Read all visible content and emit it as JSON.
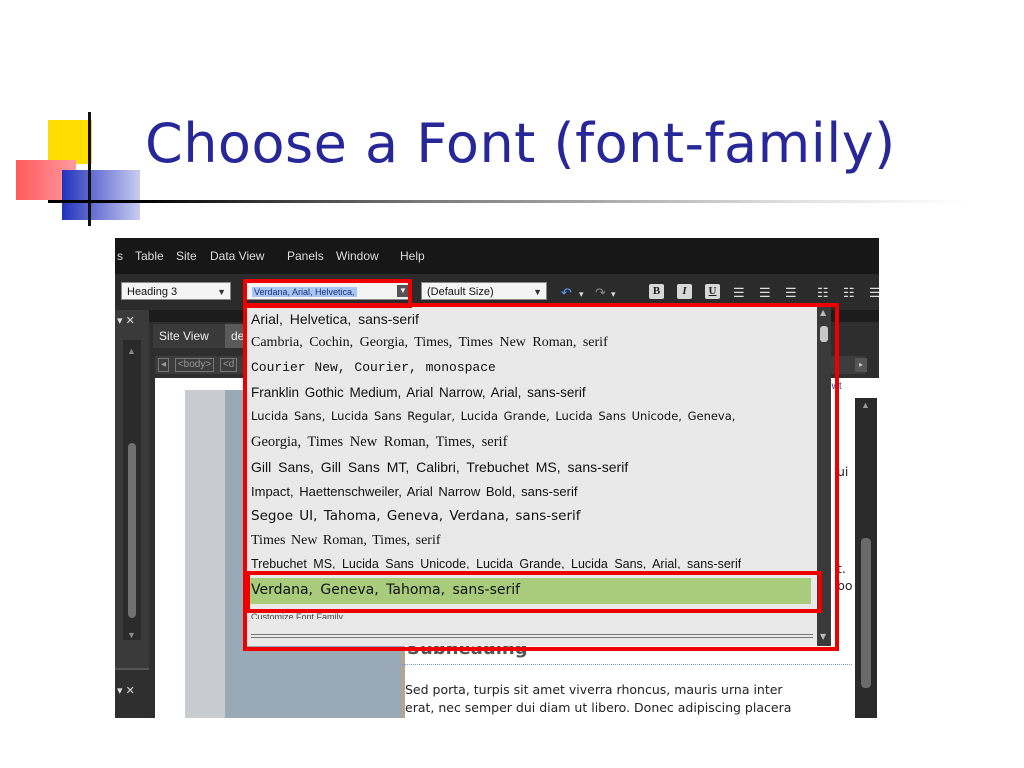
{
  "slide": {
    "title": "Choose a Font (font-family)"
  },
  "menubar": {
    "items": [
      "s",
      "Table",
      "Site",
      "Data View",
      "Panels",
      "Window",
      "Help"
    ]
  },
  "toolbar": {
    "format_value": "Heading 3",
    "font_value": "Verdana, Arial, Helvetica,",
    "size_value": "(Default Size)",
    "bold_label": "B",
    "italic_label": "I",
    "underline_label": "U"
  },
  "panels": {
    "site_tab": "Site View",
    "doc_tab": "de",
    "tag_body": "<body>",
    "tag_div": "<d",
    "file_tab": "er.dwt"
  },
  "canvas": {
    "frag1": "ui",
    "frag2": "t.",
    "frag3": "bo",
    "subheading": "Subheading",
    "body_line1": "Sed porta, turpis sit amet viverra rhoncus, mauris urna inter",
    "body_line2": "erat, nec semper dui diam ut libero. Donec adipiscing placera"
  },
  "font_list": {
    "items": [
      "Arial, Helvetica, sans-serif",
      "Cambria, Cochin, Georgia, Times, Times New Roman, serif",
      "Courier New, Courier, monospace",
      "Franklin Gothic Medium, Arial Narrow, Arial, sans-serif",
      "Lucida Sans, Lucida Sans Regular, Lucida Grande, Lucida Sans Unicode, Geneva,",
      "Georgia, Times New Roman, Times, serif",
      "Gill Sans, Gill Sans MT, Calibri, Trebuchet MS, sans-serif",
      "Impact, Haettenschweiler, Arial Narrow Bold, sans-serif",
      "Segoe UI, Tahoma, Geneva, Verdana, sans-serif",
      "Times New Roman, Times, serif",
      "Trebuchet MS, Lucida Sans Unicode, Lucida Grande, Lucida Sans, Arial, sans-serif",
      "Verdana, Geneva, Tahoma, sans-serif"
    ],
    "customize": "Customize Font Family..."
  },
  "colors": {
    "highlight": "#ee0000",
    "selected": "#a8cc7c",
    "title": "#27279a"
  }
}
